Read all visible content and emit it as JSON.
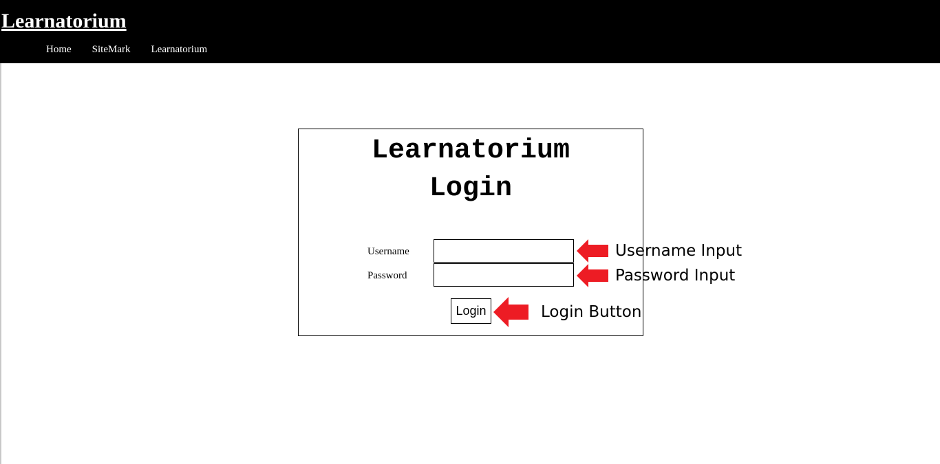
{
  "header": {
    "site_title": "Learnatorium",
    "nav": [
      {
        "label": "Home"
      },
      {
        "label": "SiteMark"
      },
      {
        "label": "Learnatorium"
      }
    ]
  },
  "login": {
    "title_line1": "Learnatorium",
    "title_line2": "Login",
    "username_label": "Username",
    "username_value": "",
    "password_label": "Password",
    "password_value": "",
    "button_label": "Login"
  },
  "annotations": {
    "username": "Username Input",
    "password": "Password Input",
    "button": "Login Button",
    "arrow_color": "#ed1c24",
    "arrow_icon": "arrow-left-icon"
  }
}
